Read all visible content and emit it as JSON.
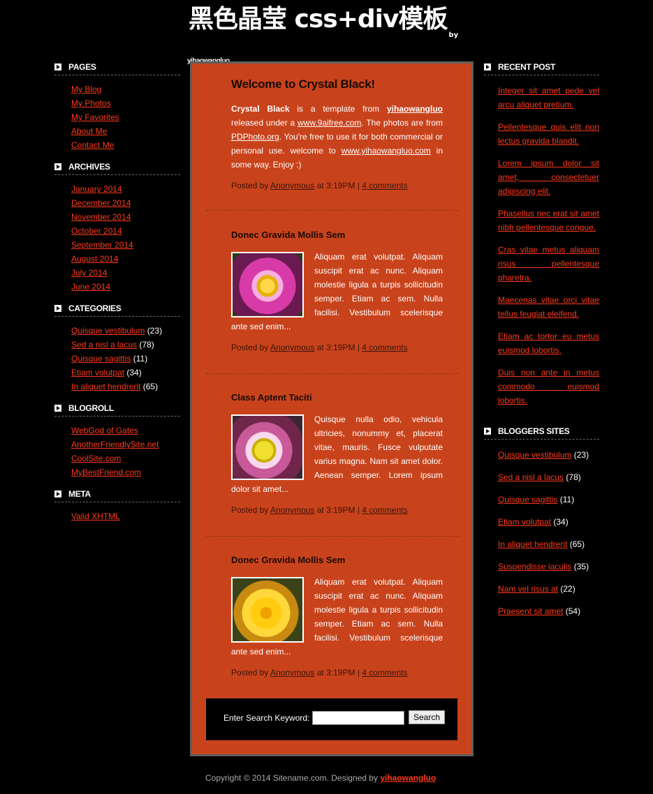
{
  "header": {
    "title": "黑色晶莹 css+div模板",
    "title_sub": "by",
    "byline": "yihaowangluo"
  },
  "left_sidebar": {
    "pages": {
      "heading": "PAGES",
      "items": [
        "My Blog",
        "My Photos",
        "My Favorites",
        "About Me",
        "Contact Me"
      ]
    },
    "archives": {
      "heading": "ARCHIVES",
      "items": [
        "January 2014",
        "December 2014",
        "November 2014",
        "October 2014",
        "September 2014",
        "August 2014",
        "July 2014",
        "June 2014"
      ]
    },
    "categories": {
      "heading": "CATEGORIES",
      "items": [
        {
          "label": "Quisque vestibulum",
          "count": "(23)"
        },
        {
          "label": "Sed a nisl a lacus",
          "count": "(78)"
        },
        {
          "label": "Quisque sagittis",
          "count": "(11)"
        },
        {
          "label": "Etiam volutpat",
          "count": "(34)"
        },
        {
          "label": "In aliquet hendrerit",
          "count": "(65)"
        }
      ]
    },
    "blogroll": {
      "heading": "BLOGROLL",
      "items": [
        "WebGod of Gates",
        "AnotherFriendlySite.net",
        "CoolSite.com",
        "MyBestFriend.com"
      ]
    },
    "meta": {
      "heading": "META",
      "items": [
        "Valid XHTML"
      ]
    }
  },
  "main": {
    "welcome": {
      "title": "Welcome to Crystal Black!",
      "body_strong": "Crystal Black",
      "body_1": " is a template from ",
      "link_1": "yihaowangluo",
      "body_2": " released under a ",
      "link_2": "www.9aifree.com",
      "body_3": ". The photos are from ",
      "link_3": "PDPhoto.org",
      "body_4": ". You're free to use it for both commercial or personal use. welcome to ",
      "link_4": "www.yihaowangluo.com",
      "body_5": " in some way. Enjoy :)",
      "meta_prefix": "Posted by ",
      "author": "Anonymous",
      "meta_mid": " at 3:19PM | ",
      "comments": "4 comments"
    },
    "posts": [
      {
        "title": "Donec Gravida Mollis Sem",
        "body": "Aliquam erat volutpat. Aliquam suscipit erat ac nunc. Aliquam molestie ligula a turpis sollicitudin semper. Etiam ac sem. Nulla facilisi. Vestibulum scelerisque ante sed enim...",
        "meta_prefix": "Posted by ",
        "author": "Anonymous",
        "meta_mid": " at 3:19PM | ",
        "comments": "4 comments"
      },
      {
        "title": "Class Aptent Taciti",
        "body": "Quisque nulla odio, vehicula ultricies, nonummy et, placerat vitae, mauris. Fusce vulputate varius magna. Nam sit amet dolor. Aenean semper. Lorem ipsum dolor sit amet...",
        "meta_prefix": "Posted by ",
        "author": "Anonymous",
        "meta_mid": " at 3:19PM | ",
        "comments": "4 comments"
      },
      {
        "title": "Donec Gravida Mollis Sem",
        "body": "Aliquam erat volutpat. Aliquam suscipit erat ac nunc. Aliquam molestie ligula a turpis sollicitudin semper. Etiam ac sem. Nulla facilisi. Vestibulum scelerisque ante sed enim...",
        "meta_prefix": "Posted by ",
        "author": "Anonymous",
        "meta_mid": " at 3:19PM | ",
        "comments": "4 comments"
      }
    ],
    "search": {
      "label": "Enter Search Keyword:",
      "value": "",
      "button": "Search"
    }
  },
  "right_sidebar": {
    "recent_post": {
      "heading": "RECENT POST",
      "items": [
        "Integer sit amet pede vel arcu aliquet pretium.",
        "Pellentesque quis elit non lectus gravida blandit.",
        "Lorem ipsum dolor sit amet, consectetuer adipiscing elit.",
        "Phasellus nec erat sit amet nibh pellentesque congue.",
        "Cras vitae metus aliquam risus pellentesque pharetra.",
        "Maecenas vitae orci vitae tellus feugiat eleifend.",
        "Etiam ac tortor eu metus euismod lobortis.",
        "Duis non ante in metus commodo euismod lobortis."
      ]
    },
    "bloggers_sites": {
      "heading": "BLOGGERS SITES",
      "items": [
        {
          "label": "Quisque vestibulum",
          "count": "(23)"
        },
        {
          "label": "Sed a nisl a lacus",
          "count": "(78)"
        },
        {
          "label": "Quisque sagittis",
          "count": "(11)"
        },
        {
          "label": "Etiam volutpat",
          "count": "(34)"
        },
        {
          "label": "In aliquet hendrerit",
          "count": "(65)"
        },
        {
          "label": "Suspendisse iaculis",
          "count": "(35)"
        },
        {
          "label": "Nam vel risus at",
          "count": "(22)"
        },
        {
          "label": "Praesent sit amet",
          "count": "(54)"
        }
      ]
    }
  },
  "footer": {
    "text": "Copyright © 2014 Sitename.com. Designed by ",
    "link": "yihaowangluo"
  },
  "colors": {
    "background": "#000000",
    "content_panel": "#c8431c",
    "link": "#ff3a1a",
    "panel_border": "#5e5e5e"
  }
}
